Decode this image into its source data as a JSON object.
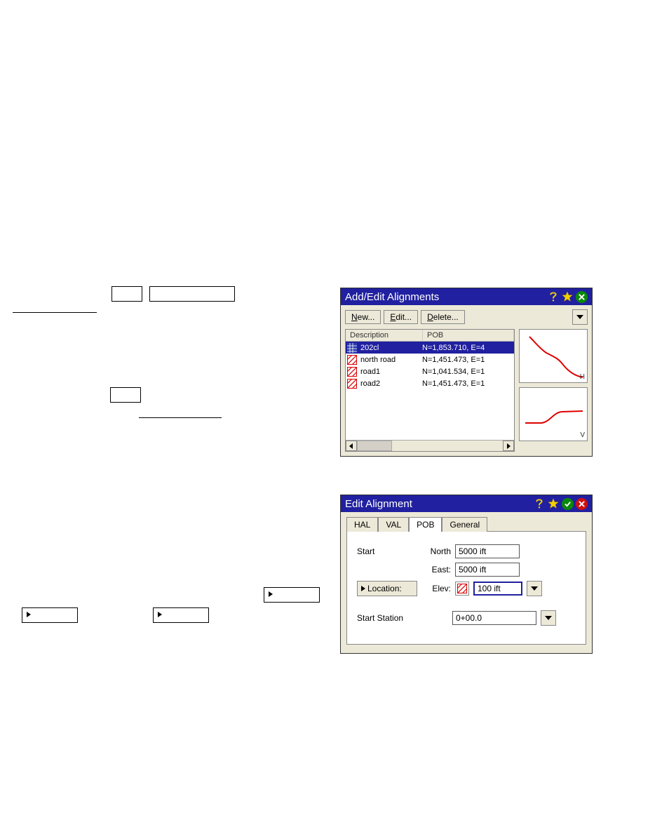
{
  "dialog1": {
    "title": "Add/Edit Alignments",
    "buttons": {
      "new": "New...",
      "edit": "Edit...",
      "delete": "Delete..."
    },
    "columns": {
      "description": "Description",
      "pob": "POB"
    },
    "rows": [
      {
        "desc": "202cl",
        "pob": "N=1,853.710, E=4",
        "icon": "blue-hatch",
        "selected": true
      },
      {
        "desc": "north road",
        "pob": "N=1,451.473, E=1",
        "icon": "red-hatch",
        "selected": false
      },
      {
        "desc": "road1",
        "pob": "N=1,041.534, E=1",
        "icon": "red-hatch",
        "selected": false
      },
      {
        "desc": "road2",
        "pob": "N=1,451.473, E=1",
        "icon": "red-hatch",
        "selected": false
      }
    ],
    "preview_h": "H",
    "preview_v": "V"
  },
  "dialog2": {
    "title": "Edit Alignment",
    "tabs": {
      "hal": "HAL",
      "val": "VAL",
      "pob": "POB",
      "general": "General"
    },
    "active_tab": "pob",
    "labels": {
      "start": "Start",
      "north": "North",
      "east": "East:",
      "elev": "Elev:",
      "location": "Location:",
      "start_station": "Start Station"
    },
    "values": {
      "north": "5000 ift",
      "east": "5000 ift",
      "elev": "100 ift",
      "start_station": "0+00.0"
    }
  }
}
